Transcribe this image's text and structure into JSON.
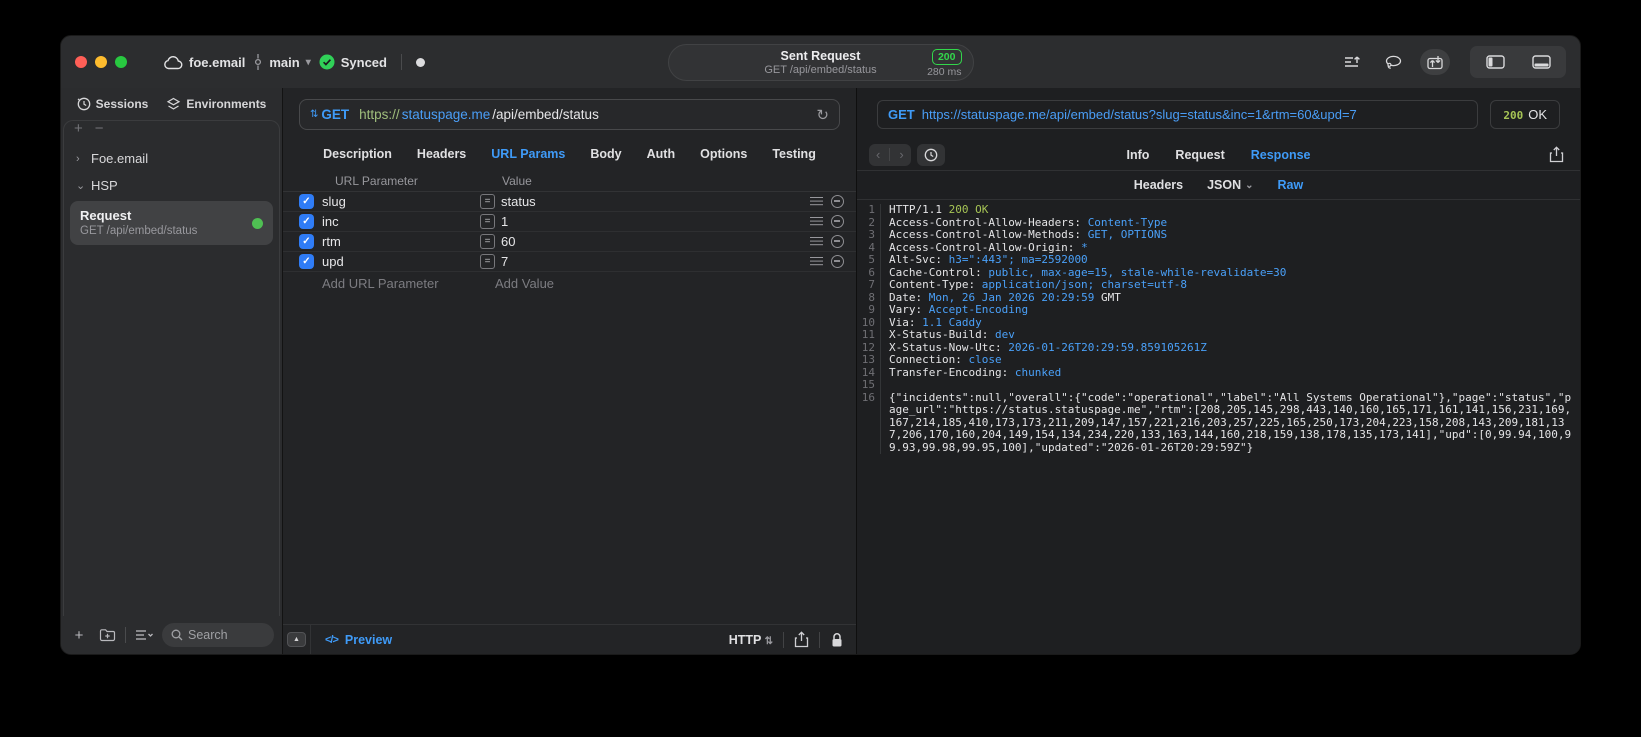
{
  "colors": {
    "accent_blue": "#3f9bf8",
    "code_blue": "#4aa0f8",
    "status_green": "#32d74b",
    "lime_green": "#a6c455",
    "checkbox_blue": "#2f7cf6"
  },
  "titlebar": {
    "project": "foe.email",
    "branch": "main",
    "sync_label": "Synced",
    "request_title": "Sent Request",
    "request_subtitle": "GET /api/embed/status",
    "status_code": "200",
    "duration": "280 ms"
  },
  "sidebar": {
    "tabs": [
      {
        "label": "Sessions"
      },
      {
        "label": "Environments"
      }
    ],
    "add_label": "+",
    "remove_label": "−",
    "tree": [
      {
        "label": "Foe.email"
      },
      {
        "label": "HSP"
      }
    ],
    "request_item": {
      "title": "Request",
      "subtitle": "GET /api/embed/status"
    },
    "search_placeholder": "Search"
  },
  "request_editor": {
    "method": "GET",
    "url": {
      "scheme": "https://",
      "host": "statuspage.me",
      "path": "/api/embed/status"
    },
    "tabs": [
      "Description",
      "Headers",
      "URL Params",
      "Body",
      "Auth",
      "Options",
      "Testing"
    ],
    "active_tab": "URL Params",
    "params": {
      "col_param": "URL Parameter",
      "col_value": "Value",
      "rows": [
        {
          "name": "slug",
          "value": "status",
          "enabled": true
        },
        {
          "name": "inc",
          "value": "1",
          "enabled": true
        },
        {
          "name": "rtm",
          "value": "60",
          "enabled": true
        },
        {
          "name": "upd",
          "value": "7",
          "enabled": true
        }
      ],
      "add_param_label": "Add URL Parameter",
      "add_value_label": "Add Value"
    },
    "footer": {
      "preview_label": "Preview",
      "code_glyph": "</>",
      "protocol_label": "HTTP"
    }
  },
  "response_viewer": {
    "method": "GET",
    "url": "https://statuspage.me/api/embed/status?slug=status&inc=1&rtm=60&upd=7",
    "status_code": "200",
    "status_text": "OK",
    "tabs": [
      "Info",
      "Request",
      "Response"
    ],
    "active_tab": "Response",
    "subtabs": [
      "Headers",
      "JSON",
      "Raw"
    ],
    "active_subtab": "Raw",
    "body_lines": [
      {
        "n": "1",
        "segs": [
          {
            "t": "HTTP/1.1 ",
            "c": "p"
          },
          {
            "t": "200 OK",
            "c": "g"
          }
        ]
      },
      {
        "n": "2",
        "segs": [
          {
            "t": "Access-Control-Allow-Headers: ",
            "c": "p"
          },
          {
            "t": "Content-Type",
            "c": "b"
          }
        ]
      },
      {
        "n": "3",
        "segs": [
          {
            "t": "Access-Control-Allow-Methods: ",
            "c": "p"
          },
          {
            "t": "GET, OPTIONS",
            "c": "b"
          }
        ]
      },
      {
        "n": "4",
        "segs": [
          {
            "t": "Access-Control-Allow-Origin: ",
            "c": "p"
          },
          {
            "t": "*",
            "c": "b"
          }
        ]
      },
      {
        "n": "5",
        "segs": [
          {
            "t": "Alt-Svc: ",
            "c": "p"
          },
          {
            "t": "h3=\":443\"; ma=2592000",
            "c": "b"
          }
        ]
      },
      {
        "n": "6",
        "segs": [
          {
            "t": "Cache-Control: ",
            "c": "p"
          },
          {
            "t": "public, max-age=15, stale-while-revalidate=30",
            "c": "b"
          }
        ]
      },
      {
        "n": "7",
        "segs": [
          {
            "t": "Content-Type: ",
            "c": "p"
          },
          {
            "t": "application/json; charset=utf-8",
            "c": "b"
          }
        ]
      },
      {
        "n": "8",
        "segs": [
          {
            "t": "Date: ",
            "c": "p"
          },
          {
            "t": "Mon, 26 Jan 2026 20:29:59",
            "c": "b"
          },
          {
            "t": " GMT",
            "c": "p"
          }
        ]
      },
      {
        "n": "9",
        "segs": [
          {
            "t": "Vary: ",
            "c": "p"
          },
          {
            "t": "Accept-Encoding",
            "c": "b"
          }
        ]
      },
      {
        "n": "10",
        "segs": [
          {
            "t": "Via: ",
            "c": "p"
          },
          {
            "t": "1.1 Caddy",
            "c": "b"
          }
        ]
      },
      {
        "n": "11",
        "segs": [
          {
            "t": "X-Status-Build: ",
            "c": "p"
          },
          {
            "t": "dev",
            "c": "b"
          }
        ]
      },
      {
        "n": "12",
        "segs": [
          {
            "t": "X-Status-Now-Utc: ",
            "c": "p"
          },
          {
            "t": "2026-01-26T20:29:59.859105261Z",
            "c": "b"
          }
        ]
      },
      {
        "n": "13",
        "segs": [
          {
            "t": "Connection: ",
            "c": "p"
          },
          {
            "t": "close",
            "c": "b"
          }
        ]
      },
      {
        "n": "14",
        "segs": [
          {
            "t": "Transfer-Encoding: ",
            "c": "p"
          },
          {
            "t": "chunked",
            "c": "b"
          }
        ]
      },
      {
        "n": "15",
        "segs": []
      },
      {
        "n": "16",
        "segs": [
          {
            "t": "{\"incidents\":null,\"overall\":{\"code\":\"operational\",\"label\":\"All Systems Operational\"},\"page\":\"status\",\"page_url\":\"https://status.statuspage.me\",\"rtm\":[208,205,145,298,443,140,160,165,171,161,141,156,231,169,167,214,185,410,173,173,211,209,147,157,221,216,203,257,225,165,250,173,204,223,158,208,143,209,181,137,206,170,160,204,149,154,134,234,220,133,163,144,160,218,159,138,178,135,173,141],\"upd\":[0,99.94,100,99.93,99.98,99.95,100],\"updated\":\"2026-01-26T20:29:59Z\"}",
            "c": "p"
          }
        ]
      }
    ]
  }
}
